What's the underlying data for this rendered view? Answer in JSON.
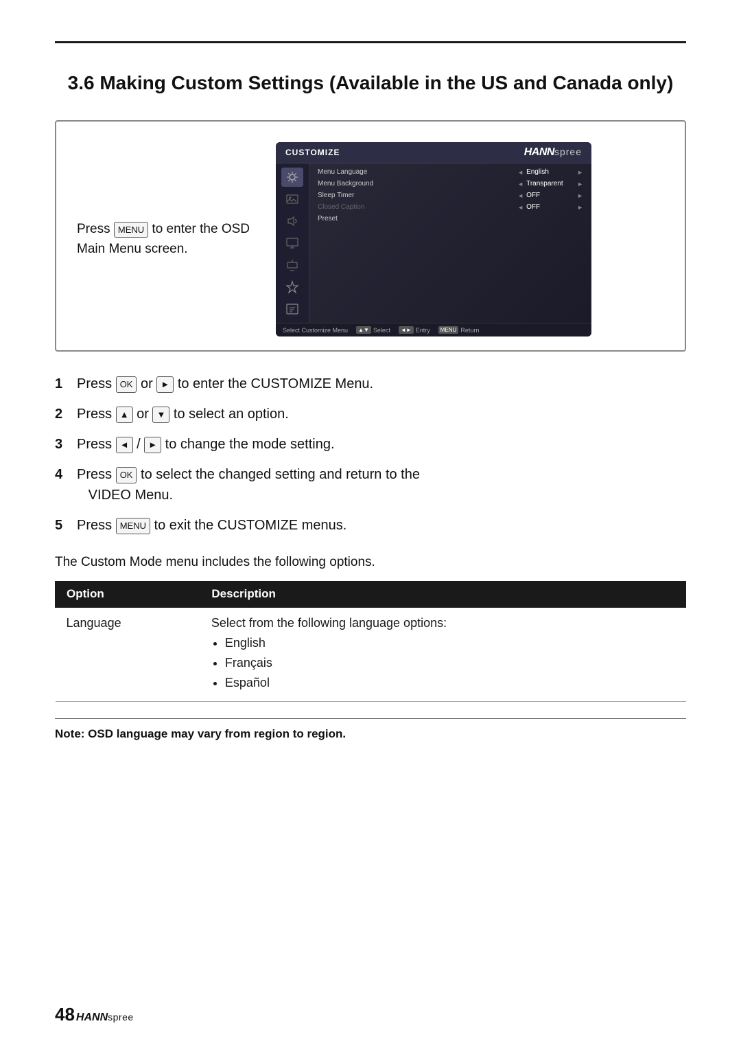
{
  "page": {
    "title": "3.6  Making Custom Settings (Available in the US and Canada only)",
    "brand": {
      "hann": "HANN",
      "spree": "spree"
    }
  },
  "screenshot": {
    "press_text_line1": "Press",
    "menu_key": "MENU",
    "press_text_line2": "to enter the OSD",
    "press_text_line3": "Main Menu screen.",
    "osd": {
      "title": "CUSTOMIZE",
      "brand_hann": "HANN",
      "brand_spree": "spree",
      "menu_rows": [
        {
          "label": "Menu Language",
          "value": "English",
          "dimmed": false
        },
        {
          "label": "Menu Background",
          "value": "Transparent",
          "dimmed": false
        },
        {
          "label": "Sleep Timer",
          "value": "OFF",
          "dimmed": false
        },
        {
          "label": "Closed Caption",
          "value": "OFF",
          "dimmed": true
        },
        {
          "label": "Preset",
          "value": "",
          "dimmed": false
        }
      ],
      "footer_items": [
        {
          "key": "▲▼",
          "label": "Select"
        },
        {
          "key": "◄►",
          "label": "Entry"
        },
        {
          "key": "MENU",
          "label": "Return"
        }
      ]
    }
  },
  "steps": [
    {
      "number": "1",
      "text": "Press",
      "key": "OK",
      "connector": "or",
      "key2": "►",
      "tail": "to enter the CUSTOMIZE Menu."
    },
    {
      "number": "2",
      "text": "Press",
      "key": "▲",
      "connector": "or",
      "key2": "▼",
      "tail": "to select an option."
    },
    {
      "number": "3",
      "text": "Press",
      "key": "◄",
      "connector": "/",
      "key2": "►",
      "tail": "to change the mode setting."
    },
    {
      "number": "4",
      "text": "Press",
      "key": "OK",
      "tail": "to select the changed setting and return to the",
      "tail2": "VIDEO Menu."
    },
    {
      "number": "5",
      "text": "Press",
      "key": "MENU",
      "tail": "to exit the CUSTOMIZE menus."
    }
  ],
  "table_intro": "The Custom Mode menu includes the following options.",
  "table": {
    "headers": [
      "Option",
      "Description"
    ],
    "rows": [
      {
        "option": "Language",
        "description_prefix": "Select from the following language options:",
        "bullets": [
          "English",
          "Français",
          "Español"
        ]
      }
    ]
  },
  "note": "Note: OSD language may vary from region to region.",
  "footer": {
    "page_number": "48",
    "brand_hann": "HANN",
    "brand_spree": "spree"
  }
}
